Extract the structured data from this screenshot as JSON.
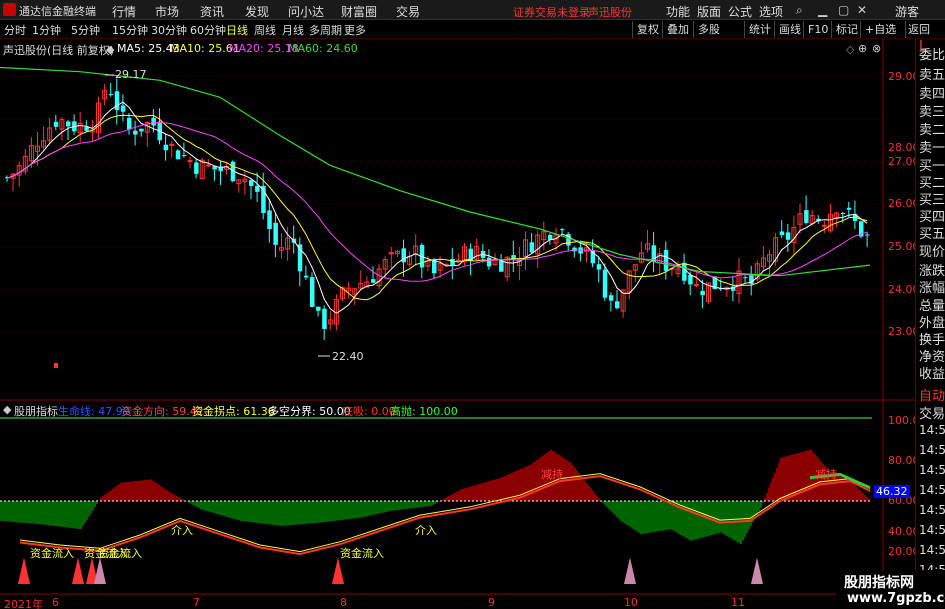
{
  "title_bar": {
    "app_name": "通达信金融终端",
    "menus": [
      "行情",
      "市场",
      "资讯",
      "发现",
      "问小达",
      "财富圈",
      "交易"
    ],
    "login_status": "证券交易未登录",
    "stock_name": "声迅股份",
    "right_buttons": [
      "功能",
      "版面",
      "公式",
      "选项"
    ],
    "guest": "游客",
    "window_controls": [
      "⌕",
      "▁",
      "▢",
      "✕"
    ]
  },
  "toolbar": {
    "periods": [
      "分时",
      "1分钟",
      "5分钟",
      "15分钟",
      "30分钟",
      "60分钟",
      "日线",
      "周线",
      "月线",
      "多周期",
      "更多"
    ],
    "active_period": "日线",
    "right_buttons": [
      "复权",
      "叠加",
      "多股",
      "统计",
      "画线",
      "F10",
      "标记",
      "+自选",
      "返回"
    ]
  },
  "main_chart": {
    "title": "声迅股份(日线 前复权)",
    "ma_labels": [
      {
        "text": "MA5: 25.43",
        "color": "#ffffff"
      },
      {
        "text": "MA10: 25.61",
        "color": "#ffff33"
      },
      {
        "text": "MA20: 25.18",
        "color": "#ff44ff"
      },
      {
        "text": "MA60: 24.60",
        "color": "#33dd33"
      }
    ],
    "high_label": "29.17",
    "low_label": "22.40",
    "y_ticks": [
      "29.00",
      "28.00",
      "27.00",
      "26.00",
      "25.00",
      "24.00",
      "23.00"
    ]
  },
  "indicator": {
    "name": "股朋指标",
    "legend": [
      {
        "text": "生命线: 47.99",
        "color": "#3355ff"
      },
      {
        "text": "资金方向: 59.42",
        "color": "#ff4444"
      },
      {
        "text": "资金拐点: 61.36",
        "color": "#ffff33"
      },
      {
        "text": "多空分界: 50.00",
        "color": "#ffffff"
      },
      {
        "text": "底吸: 0.00",
        "color": "#ff3333"
      },
      {
        "text": "高抛: 100.00",
        "color": "#33ff33"
      }
    ],
    "y_ticks": [
      "100.0",
      "80.00",
      "60.00",
      "40.00",
      "20.00"
    ],
    "current_value": "46.32",
    "annotations": [
      "资金流入",
      "资金流入",
      "资金流入",
      "介入",
      "资金流入",
      "介入",
      "减持",
      "减持"
    ]
  },
  "x_axis": {
    "labels": [
      "2021年",
      "6",
      "7",
      "8",
      "9",
      "10",
      "11"
    ]
  },
  "right_panel": {
    "items": [
      "L",
      "委比",
      "卖五",
      "卖四",
      "卖三",
      "卖二",
      "卖一",
      "买一",
      "买二",
      "买三",
      "买四",
      "买五",
      "现价",
      "涨跌",
      "涨幅",
      "总量",
      "外盘",
      "换手",
      "净资",
      "收益"
    ],
    "lower_items": [
      "自动",
      "交易",
      "14:5",
      "14:5",
      "14:5",
      "14:5",
      "14:5",
      "14:5",
      "14:5",
      "14:5"
    ]
  },
  "watermark": {
    "line1": "股朋指标网",
    "line2": "www.7gpzb.com"
  },
  "colors": {
    "up": "#ff3333",
    "down": "#33ffff",
    "ma5": "#ffffff",
    "ma10": "#ffff33",
    "ma20": "#ff44ff",
    "ma60": "#33dd33",
    "fill_red": "#8b0000",
    "fill_green": "#006400"
  }
}
